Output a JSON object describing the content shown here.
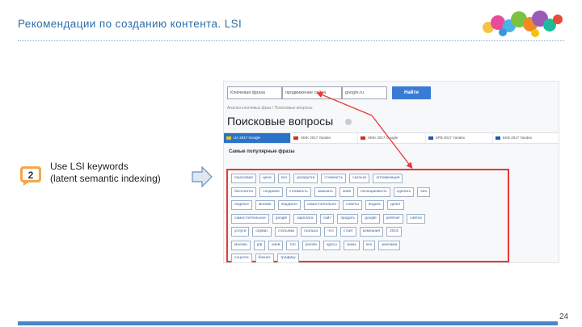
{
  "slide": {
    "title": "Рекомендации по созданию контента. LSI",
    "page_number": "24",
    "accent_color": "#2b6fa8"
  },
  "step": {
    "number": "2",
    "line1": "Use LSI keywords",
    "line2": "(latent semantic indexing)"
  },
  "screenshot": {
    "search_type": "Ключевая фраза",
    "search_query": "продвижение сайта",
    "search_region": "google.ru",
    "search_button": "Найти",
    "breadcrumb": "Анализ ключевых фраз / Поисковые вопросы",
    "heading": "Поисковые вопросы",
    "db_tabs": [
      {
        "label": "UA 2017 Google",
        "active": true
      },
      {
        "label": "MSK 2017 Yandex",
        "active": false
      },
      {
        "label": "MSK 2017 Google",
        "active": false
      },
      {
        "label": "SPB 2017 Yandex",
        "active": false
      },
      {
        "label": "EKB 2017 Yandex",
        "active": false
      }
    ],
    "popular_title": "Самые популярные фразы",
    "tag_rows": [
      [
        "поисковая",
        "цена",
        "seo",
        "раскрутка",
        "стоимость",
        "сколько",
        "оптимизация"
      ],
      [
        "бесплатно",
        "создание",
        "стоимость",
        "заказать",
        "киев",
        "посещаемость",
        "сделать",
        "seo"
      ],
      [
        "яндексе",
        "москве",
        "недорого",
        "самостоятельно",
        "советы",
        "яндекс",
        "денег"
      ],
      [
        "самостоятельное",
        "google",
        "зарплата",
        "сайт",
        "продать",
        "google",
        "рейтинг",
        "сайтах"
      ],
      [
        "услуги",
        "сервис",
        "статьями",
        "сколько",
        "что",
        "стоит",
        "компания",
        "2016"
      ],
      [
        "москва",
        "рф",
        "киев",
        "топ",
        "joomla",
        "курсы",
        "заказ",
        "seo",
        "реклама"
      ],
      [
        "соцсети",
        "бизнес",
        "трафику"
      ]
    ]
  }
}
